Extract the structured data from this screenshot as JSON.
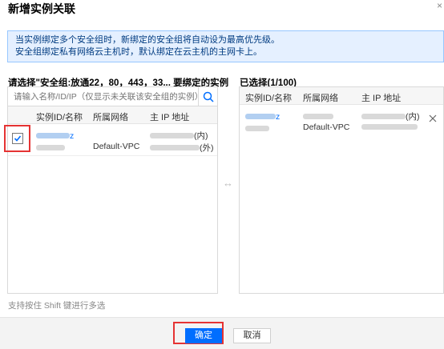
{
  "dialog": {
    "title": "新增实例关联",
    "close_glyph": "×"
  },
  "notice": {
    "line1": "当实例绑定多个安全组时，新绑定的安全组将自动设为最高优先级。",
    "line2": "安全组绑定私有网络云主机时，默认绑定在云主机的主网卡上。"
  },
  "left_panel": {
    "title": "请选择\"安全组:放通22，80，443，33... 要绑定的实例",
    "search_placeholder": "请输入名称/ID/IP（仅显示未关联该安全组的实例）",
    "search_icon": "search-icon",
    "columns": [
      "实例ID/名称",
      "所属网络",
      "主 IP 地址"
    ],
    "rows": [
      {
        "checked": true,
        "id": "ins-xxxxxx",
        "id_suffix": "z",
        "network": "Default-VPC",
        "ip_private_suffix": "(内)",
        "ip_public_suffix": "(外)"
      }
    ],
    "hint": "支持按住 Shift 键进行多选"
  },
  "right_panel": {
    "title": "已选择(1/100)",
    "columns": [
      "实例ID/名称",
      "所属网络",
      "主 IP 地址"
    ],
    "rows": [
      {
        "id_suffix": "z",
        "network": "Default-VPC",
        "ip_private_suffix": "(内)",
        "remove_icon": "close-icon"
      }
    ]
  },
  "transfer_icon": "↔",
  "footer": {
    "confirm_label": "确定",
    "cancel_label": "取消"
  },
  "colors": {
    "primary": "#006eff",
    "notice_bg": "#e5f0ff",
    "notice_border": "#97c7ff",
    "annotation_red": "#e53333"
  }
}
